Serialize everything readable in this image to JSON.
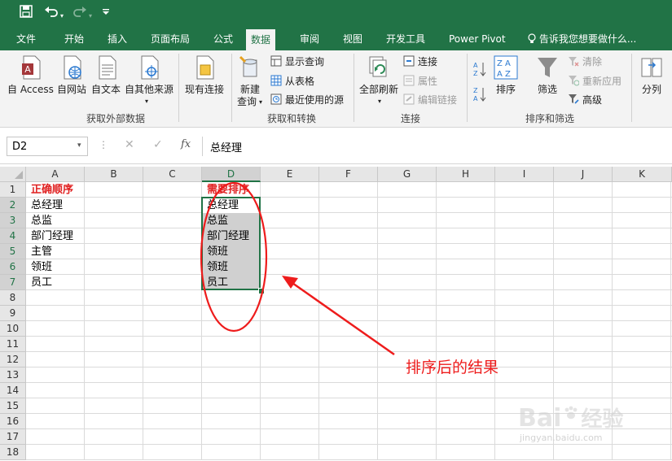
{
  "quick_access": {
    "save_icon": "save-icon",
    "undo_icon": "undo-icon",
    "redo_icon": "redo-icon",
    "customize_icon": "customize-qat-icon"
  },
  "tabs": [
    "文件",
    "开始",
    "插入",
    "页面布局",
    "公式",
    "数据",
    "审阅",
    "视图",
    "开发工具",
    "Power Pivot"
  ],
  "active_tab": "数据",
  "tell_me": "告诉我您想要做什么...",
  "ribbon": {
    "get_external": {
      "buttons": [
        "自 Access",
        "自网站",
        "自文本",
        "自其他来源",
        "现有连接"
      ],
      "group_label": "获取外部数据"
    },
    "get_transform": {
      "new_query_line1": "新建",
      "new_query_line2": "查询",
      "show_queries": "显示查询",
      "from_table": "从表格",
      "recent_sources": "最近使用的源",
      "group_label": "获取和转换"
    },
    "connections": {
      "refresh_all": "全部刷新",
      "connections": "连接",
      "properties": "属性",
      "edit_links": "编辑链接",
      "group_label": "连接"
    },
    "sort_filter": {
      "sort": "排序",
      "filter": "筛选",
      "clear": "清除",
      "reapply": "重新应用",
      "advanced": "高级",
      "group_label": "排序和筛选"
    },
    "data_tools": {
      "split": "分列"
    }
  },
  "formula_bar": {
    "name_box": "D2",
    "fx": "fx",
    "formula": "总经理"
  },
  "grid": {
    "columns": [
      "A",
      "B",
      "C",
      "D",
      "E",
      "F",
      "G",
      "H",
      "I",
      "J",
      "K"
    ],
    "rows": [
      "1",
      "2",
      "3",
      "4",
      "5",
      "6",
      "7",
      "8",
      "9",
      "10",
      "11",
      "12",
      "13",
      "14",
      "15",
      "16",
      "17",
      "18"
    ],
    "colA": [
      "正确顺序",
      "总经理",
      "总监",
      "部门经理",
      "主管",
      "领班",
      "员工"
    ],
    "colD": [
      "需要排序",
      "总经理",
      "总监",
      "部门经理",
      "领班",
      "领班",
      "员工"
    ]
  },
  "annotation": {
    "text": "排序后的结果",
    "color": "#ee1c1c"
  },
  "watermark": {
    "brand": "Bai",
    "brand2": "经验",
    "url": "jingyan.baidu.com"
  },
  "colors": {
    "excel_green": "#217346",
    "header_red": "#e02020"
  }
}
